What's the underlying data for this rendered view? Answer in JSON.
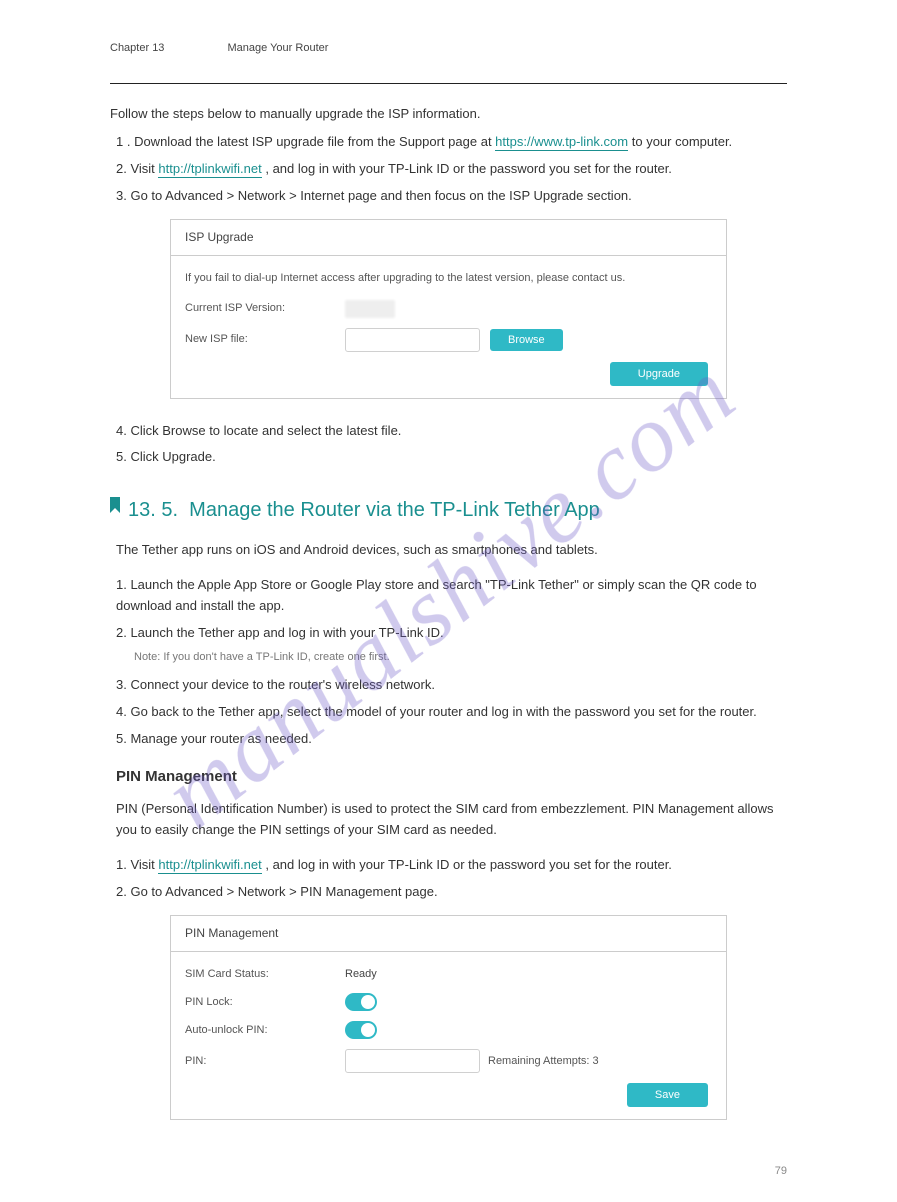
{
  "watermark": "manualshive.com",
  "chapter": {
    "num": "Chapter 13",
    "title": "Manage Your Router"
  },
  "intro_upgrade_isp": {
    "lead": "Follow the steps below to manually upgrade the ISP information.",
    "step1_prefix": "1 .  Download the latest ISP upgrade file from the Support page at ",
    "step1_link": "https://www.tp-link.com",
    "step1_suffix": " to your computer.",
    "step2": "2.  Visit ",
    "step2_link": "http://tplinkwifi.net",
    "step2_suffix": ", and log in with your TP-Link ID or the password you set for the router.",
    "step3": "3.  Go to Advanced > Network > Internet page and then focus on the ISP Upgrade section."
  },
  "isp_panel": {
    "title": "ISP Upgrade",
    "note": "If you fail to dial-up Internet access after upgrading to the latest version, please contact us.",
    "current_label": "Current ISP Version:",
    "newfile_label": "New ISP file:",
    "browse": "Browse",
    "upgrade": "Upgrade"
  },
  "steps_after_panel": {
    "s4": "4.  Click Browse to locate and select the latest file.",
    "s5": "5.  Click Upgrade."
  },
  "section": {
    "number": "13. 5.",
    "title": "Manage the Router via the TP-Link Tether App"
  },
  "tether_para_1": "The Tether app runs on iOS and Android devices, such as smartphones and tablets.",
  "tether_step1": "1.  Launch the Apple App Store or Google Play store and search \"TP-Link Tether\" or simply scan the QR code to download and install the app.",
  "tether_step2": "2.  Launch the Tether app and log in with your TP-Link ID.",
  "tether_note": "Note: If you don't have a TP-Link ID, create one first.",
  "tether_step3": "3.  Connect your device to the router's wireless network.",
  "tether_step4": "4.  Go back to the Tether app, select the model of your router and log in with the password you set for the router.",
  "tether_step5": "5.  Manage your router as needed.",
  "pin_section": {
    "subhead": "PIN Management",
    "lead": "PIN (Personal Identification Number) is used to protect the SIM card from embezzlement. PIN Management allows you to easily change the PIN settings of your SIM card as needed.",
    "s1": "1.  Visit ",
    "s1_link": "http://tplinkwifi.net",
    "s1_suffix": ", and log in with your TP-Link ID or the password you set for the router.",
    "s2": "2.  Go to Advanced > Network > PIN Management page."
  },
  "pin_panel": {
    "title": "PIN Management",
    "sim_label": "SIM Card Status:",
    "sim_value": "Ready",
    "pinlock_label": "PIN Lock:",
    "auto_label": "Auto-unlock PIN:",
    "pin_label": "PIN:",
    "attempts": "Remaining Attempts: 3",
    "save": "Save"
  },
  "page_number": "79"
}
